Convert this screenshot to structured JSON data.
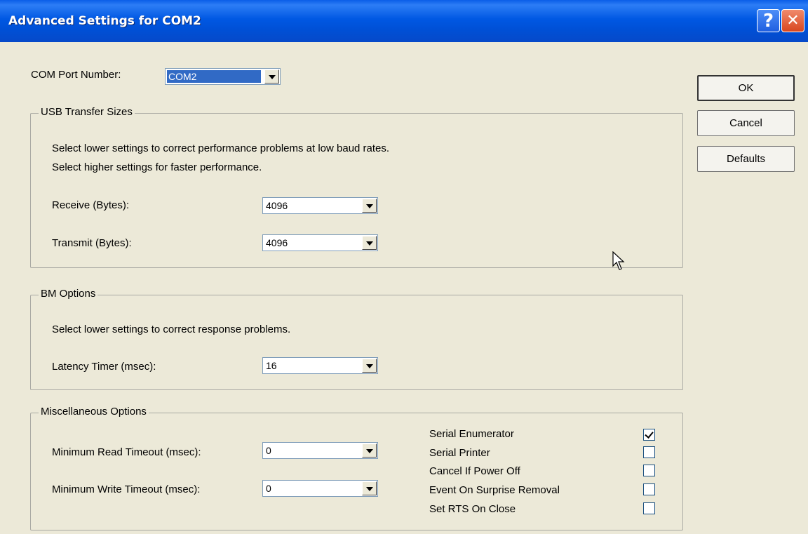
{
  "window": {
    "title": "Advanced Settings for COM2",
    "help_glyph": "?",
    "close_glyph": "✕"
  },
  "com_port": {
    "label": "COM Port Number:",
    "value": "COM2"
  },
  "usb_transfer": {
    "title": "USB Transfer Sizes",
    "line1": "Select lower settings to correct performance problems at low baud rates.",
    "line2": "Select higher settings for faster performance.",
    "receive_label": "Receive (Bytes):",
    "receive_value": "4096",
    "transmit_label": "Transmit (Bytes):",
    "transmit_value": "4096"
  },
  "bm_options": {
    "title": "BM Options",
    "line1": "Select lower settings to correct response problems.",
    "latency_label": "Latency Timer (msec):",
    "latency_value": "16"
  },
  "misc": {
    "title": "Miscellaneous Options",
    "min_read_label": "Minimum Read Timeout (msec):",
    "min_read_value": "0",
    "min_write_label": "Minimum Write Timeout (msec):",
    "min_write_value": "0",
    "options": [
      {
        "label": "Serial Enumerator",
        "checked": true
      },
      {
        "label": "Serial Printer",
        "checked": false
      },
      {
        "label": "Cancel If Power Off",
        "checked": false
      },
      {
        "label": "Event On Surprise Removal",
        "checked": false
      },
      {
        "label": "Set RTS On Close",
        "checked": false
      }
    ]
  },
  "buttons": {
    "ok": "OK",
    "cancel": "Cancel",
    "defaults": "Defaults"
  }
}
